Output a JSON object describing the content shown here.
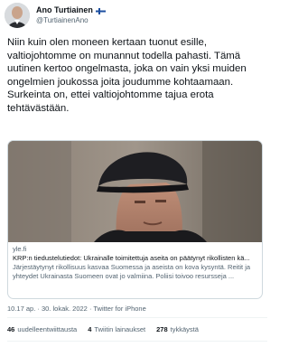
{
  "author": {
    "display_name": "Ano Turtiainen",
    "handle": "@TurtiainenAno",
    "flag_icon": "finland-flag-icon"
  },
  "tweet": {
    "text": "Niin kuin olen moneen kertaan tuonut esille,\nvaltiojohtomme on munannut todella pahasti. Tämä\nuutinen kertoo ongelmasta, joka on vain yksi muiden\nongelmien joukossa joita joudumme kohtaamaan.\nSurkeinta on, ettei valtiojohtomme tajua erota\ntehtävästään."
  },
  "card": {
    "domain": "yle.fi",
    "title": "KRP:n tiedustelutiedot: Ukrainalle toimitettuja aseita on päätynyt rikollisten kä...",
    "description_lines": [
      "Järjestäytynyt rikollisuus kasvaa Suomessa ja aseista on kova kysyntä. Reitit ja",
      "yhteydet Ukrainasta Suomeen ovat jo valmiina. Poliisi toivoo resursseja ..."
    ]
  },
  "meta": {
    "time": "10.17 ap.",
    "separator": "·",
    "date": "30. lokak. 2022",
    "app": "Twitter for iPhone"
  },
  "stats": {
    "retweets_count": "46",
    "retweets_label": "uudelleentwiittausta",
    "quotes_count": "4",
    "quotes_label": "Twiitin lainaukset",
    "likes_count": "278",
    "likes_label": "tykkäystä"
  },
  "colors": {
    "text": "#0f1419",
    "secondary": "#536471",
    "border": "#cfd9de"
  }
}
